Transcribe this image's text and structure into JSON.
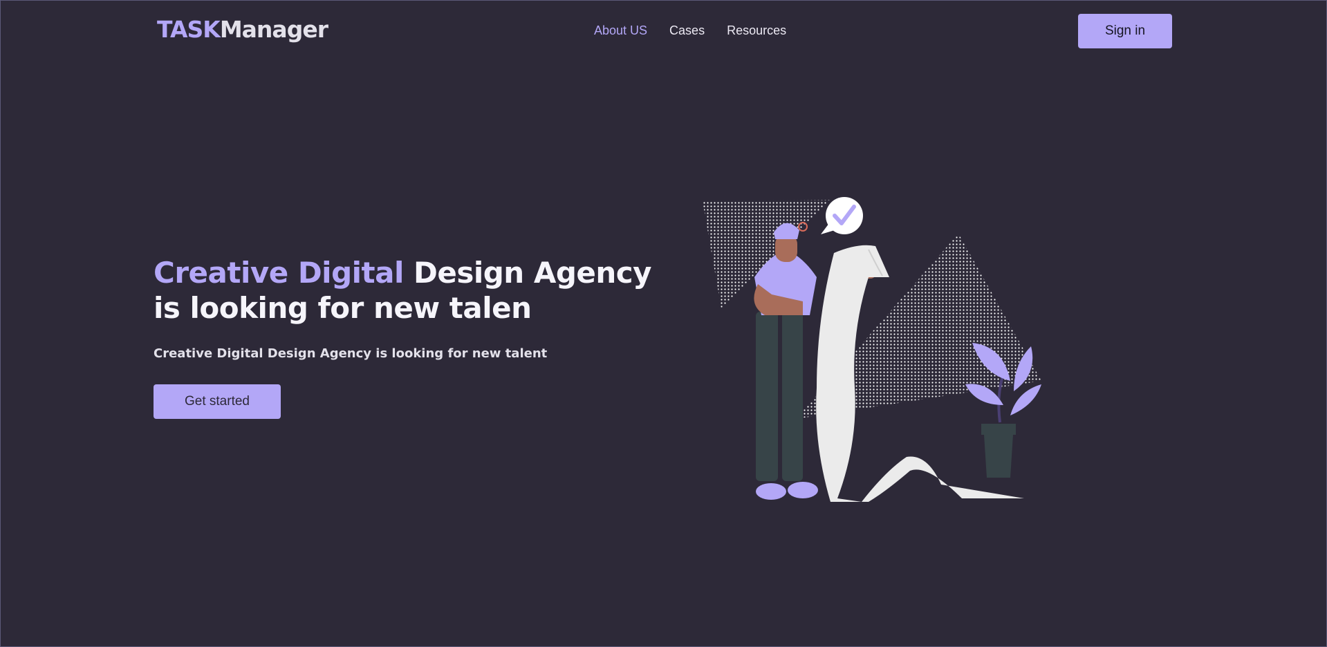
{
  "brand": {
    "part1": "TASK",
    "part2": "Manager"
  },
  "nav": {
    "items": [
      {
        "label": "About US",
        "active": true
      },
      {
        "label": "Cases",
        "active": false
      },
      {
        "label": "Resources",
        "active": false
      }
    ],
    "signin_label": "Sign in"
  },
  "hero": {
    "title_highlight": "Creative Digital",
    "title_rest_line1": "Design Agency",
    "title_line2": "is looking for new talen",
    "subtitle": "Creative Digital Design Agency is looking for new talent",
    "cta_label": "Get started"
  },
  "illustration": {
    "icon": "person-with-checklist-illustration"
  },
  "colors": {
    "background": "#2d2938",
    "accent": "#b3a7f7",
    "text": "#f6f5fb"
  }
}
